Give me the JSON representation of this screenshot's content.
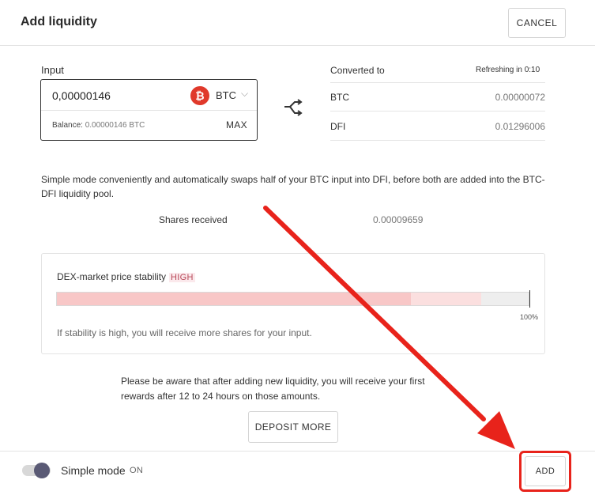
{
  "header": {
    "title": "Add liquidity",
    "cancel_label": "CANCEL"
  },
  "input": {
    "label": "Input",
    "value": "0,00000146",
    "currency": "BTC",
    "currency_icon": "bitcoin-icon",
    "balance_label": "Balance:",
    "balance_value": "0.00000146 BTC",
    "max_label": "MAX"
  },
  "converted": {
    "label": "Converted to",
    "refresh": "Refreshing in 0:10",
    "rows": [
      {
        "currency": "BTC",
        "amount": "0.00000072"
      },
      {
        "currency": "DFI",
        "amount": "0.01296006"
      }
    ]
  },
  "description": "Simple mode conveniently and automatically swaps half of your BTC input into DFI, before both are added into the BTC-DFI liquidity pool.",
  "shares": {
    "label": "Shares received",
    "value": "0.00009659"
  },
  "stability": {
    "title": "DEX-market price stability",
    "badge": "HIGH",
    "percent_label": "100%",
    "hint": "If stability is high, you will receive more shares for your input.",
    "fill_fraction": 0.9
  },
  "notice": "Please be aware that after adding new liquidity, you will receive your first rewards after 12 to 24 hours on those amounts.",
  "deposit_label": "DEPOSIT MORE",
  "footer": {
    "simple_mode_label": "Simple mode",
    "simple_mode_state": "ON",
    "add_label": "ADD"
  },
  "colors": {
    "annotation": "#e8231b",
    "btc": "#e0392b",
    "stability_badge": "#b84a5a"
  }
}
